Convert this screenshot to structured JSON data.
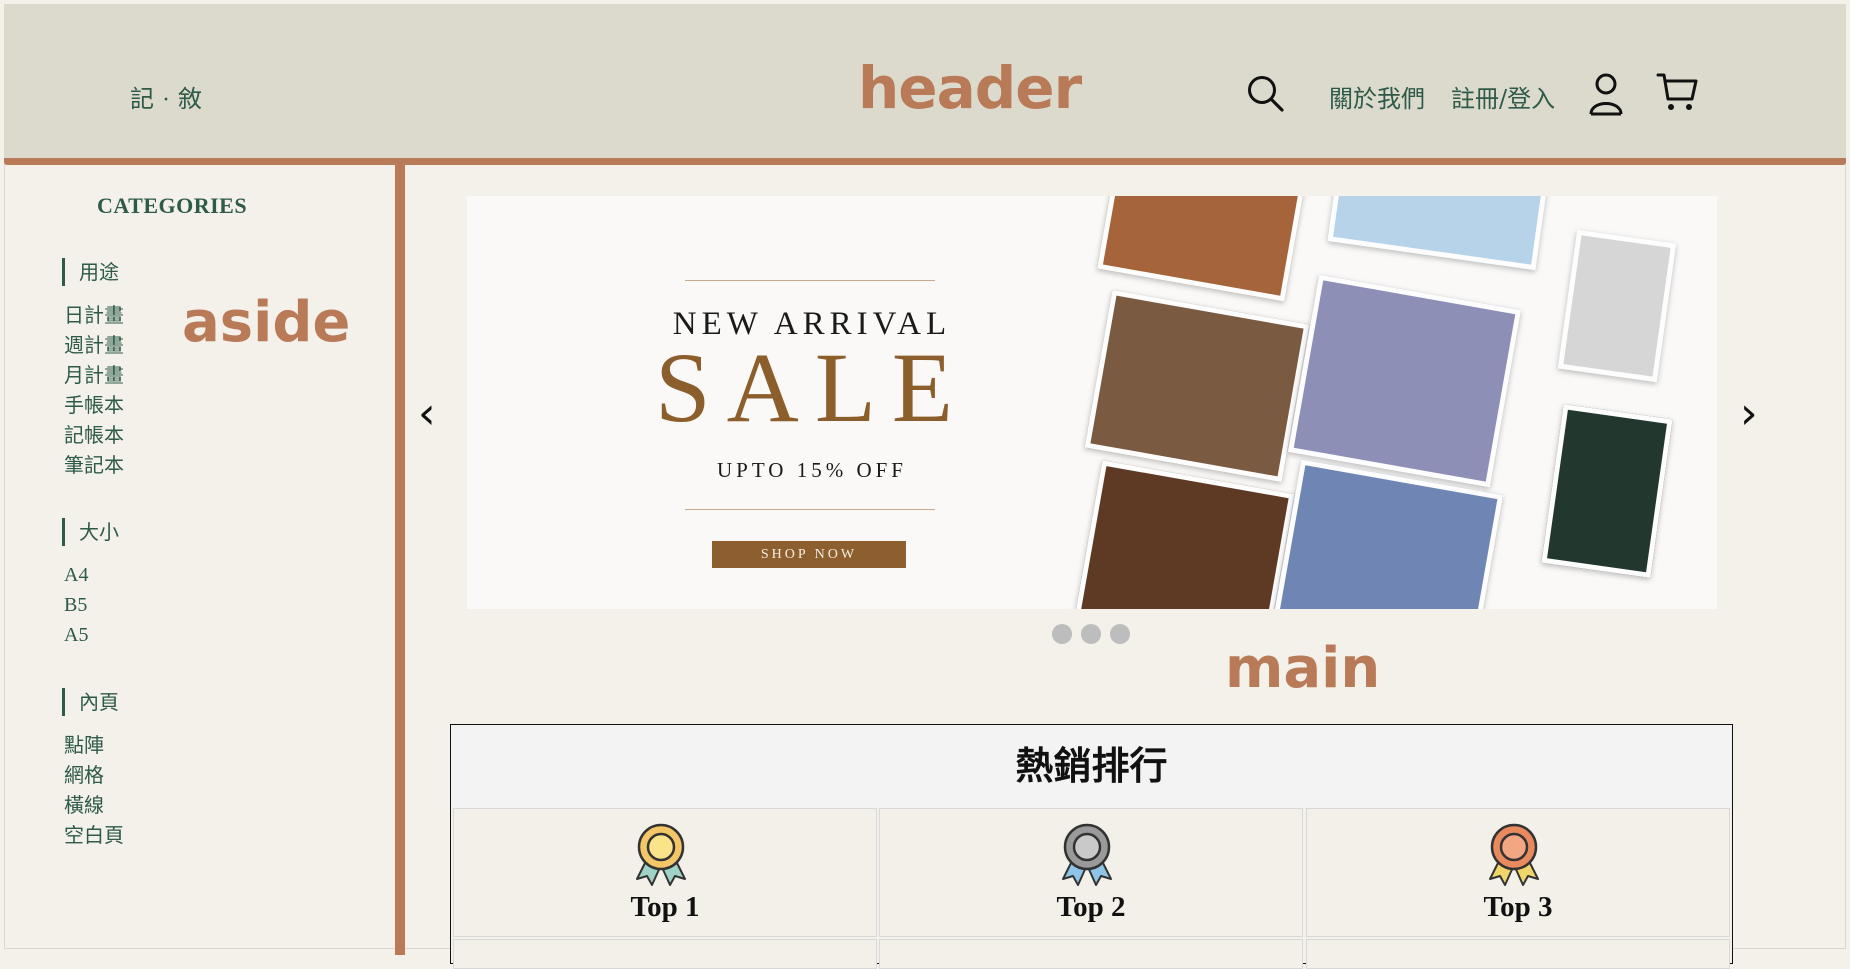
{
  "header": {
    "brand": "記 · 敘",
    "region_label": "header",
    "nav": {
      "about": "關於我們",
      "login": "註冊/登入"
    },
    "icons": [
      "search-icon",
      "user-icon",
      "cart-icon"
    ]
  },
  "aside": {
    "region_label": "aside",
    "title": "CATEGORIES",
    "groups": [
      {
        "label": "用途",
        "items": [
          "日計畫",
          "週計畫",
          "月計畫",
          "手帳本",
          "記帳本",
          "筆記本"
        ]
      },
      {
        "label": "大小",
        "items": [
          "A4",
          "B5",
          "A5"
        ]
      },
      {
        "label": "內頁",
        "items": [
          "點陣",
          "網格",
          "橫線",
          "空白頁"
        ]
      }
    ]
  },
  "main": {
    "region_label": "main",
    "carousel": {
      "prev": "‹",
      "next": "›",
      "banner": {
        "kicker": "NEW ARRIVAL",
        "headline": "SALE",
        "offer": "UPTO 15% OFF",
        "cta": "SHOP NOW"
      },
      "slide_count": 3
    },
    "ranking": {
      "title": "熱銷排行",
      "items": [
        "Top 1",
        "Top 2",
        "Top 3"
      ]
    }
  },
  "colors": {
    "accent": "#b97a58",
    "header_bg": "#dcdacd",
    "page_bg": "#f3f1ea",
    "text_green": "#2e5a48",
    "sale_brown": "#8b5e2b"
  }
}
